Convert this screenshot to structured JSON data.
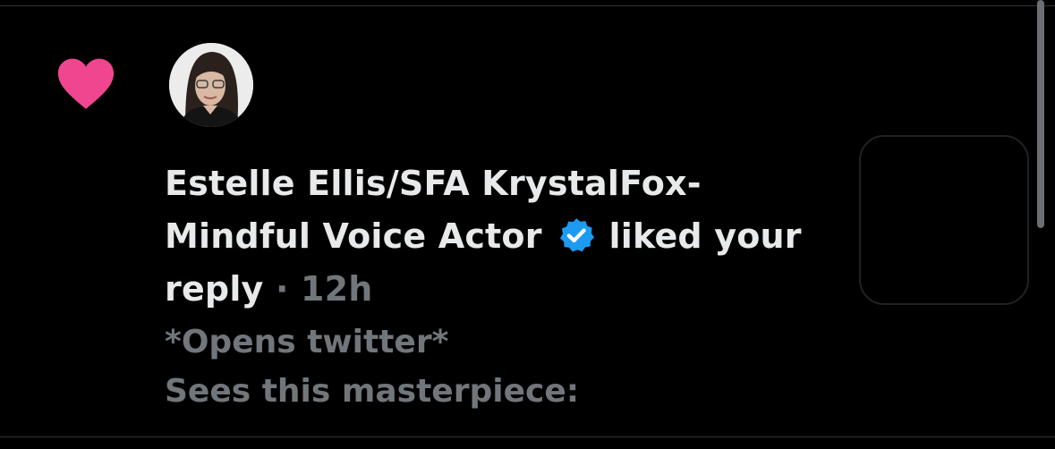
{
  "notification": {
    "type_icon": "heart-icon",
    "accent_color": "#f91880",
    "user_name": "Estelle Ellis/SFA KrystalFox-Mindful Voice Actor",
    "verified_icon": "verified-badge-icon",
    "verified_color": "#1d9bf0",
    "action": "liked your reply",
    "separator": "·",
    "time": "12h",
    "preview_lines": [
      "*Opens twitter*",
      "Sees this masterpiece:"
    ]
  }
}
